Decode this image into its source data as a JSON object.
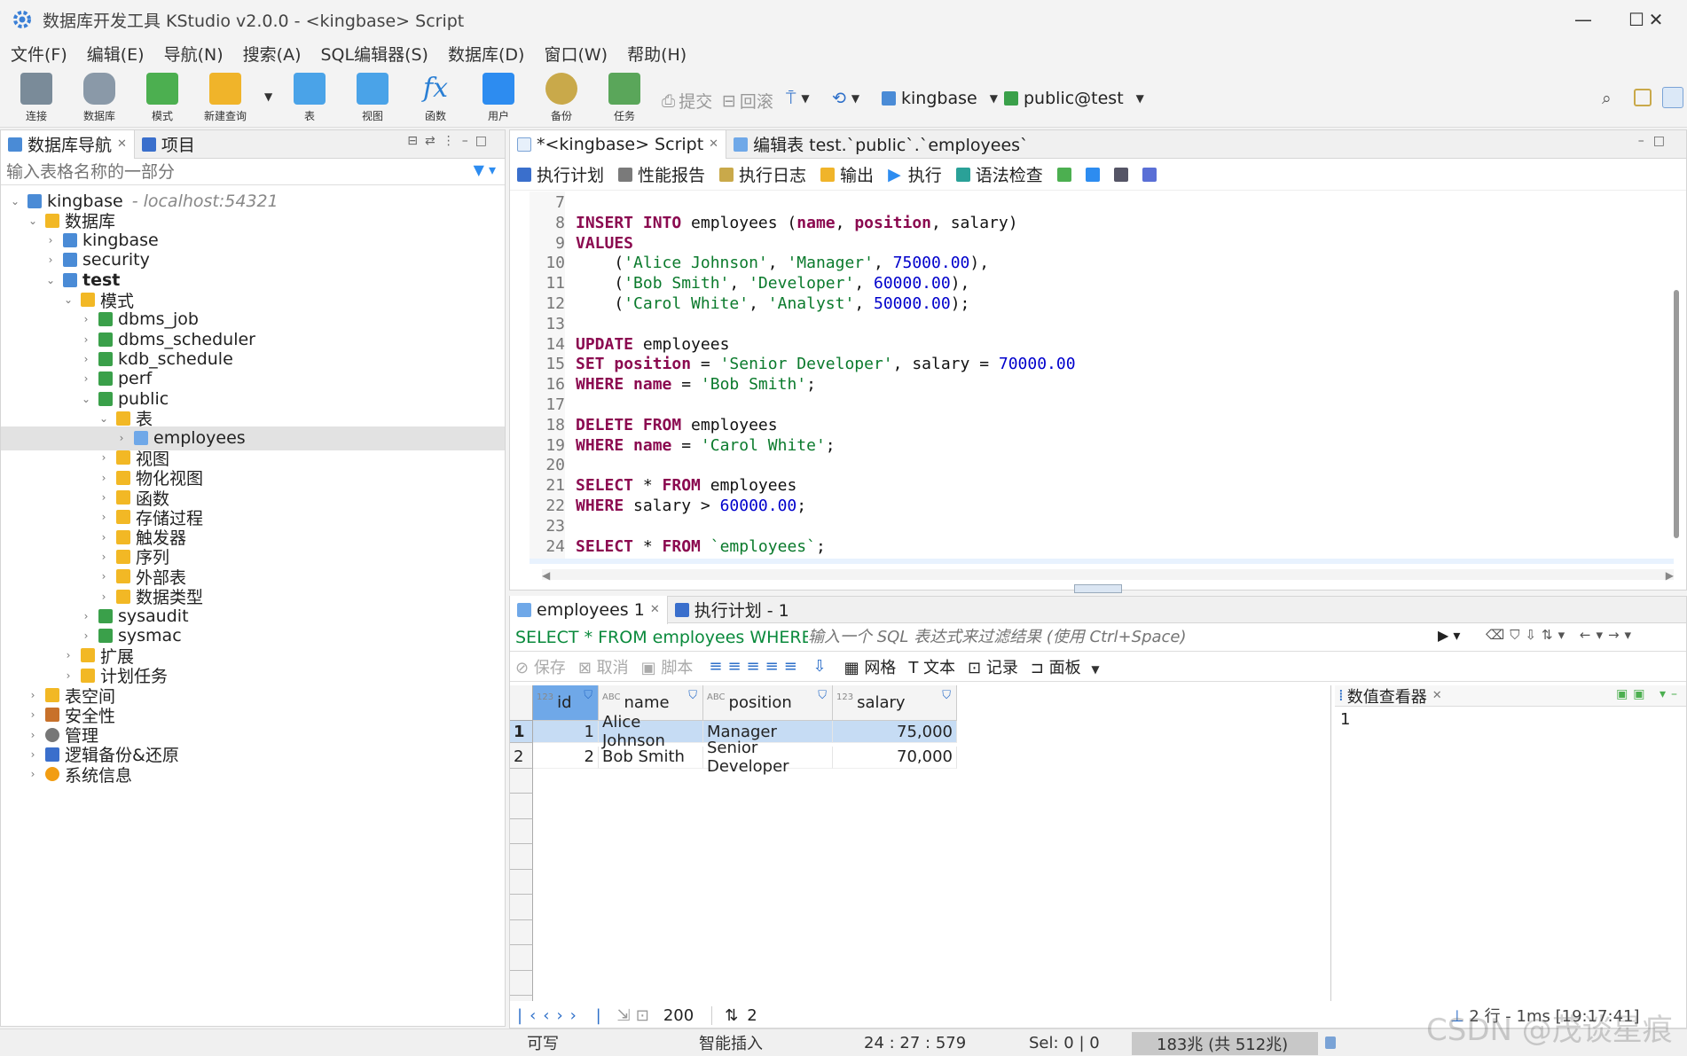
{
  "window": {
    "title": "数据库开发工具 KStudio v2.0.0 - <kingbase> Script",
    "minimize": "—",
    "maximize": "☐",
    "close": "✕"
  },
  "menu": [
    "文件(F)",
    "编辑(E)",
    "导航(N)",
    "搜索(A)",
    "SQL编辑器(S)",
    "数据库(D)",
    "窗口(W)",
    "帮助(H)"
  ],
  "toolbar": {
    "buttons": [
      {
        "label": "连接",
        "icon": "connect-icon",
        "color": "#7a8b99"
      },
      {
        "label": "数据库",
        "icon": "database-icon",
        "color": "#8a99a8"
      },
      {
        "label": "模式",
        "icon": "schema-icon",
        "color": "#4caf50"
      },
      {
        "label": "新建查询",
        "icon": "new-query-icon",
        "color": "#f0b42a"
      },
      {
        "label": "表",
        "icon": "table-icon",
        "color": "#4aa3e8"
      },
      {
        "label": "视图",
        "icon": "view-icon",
        "color": "#4aa3e8"
      },
      {
        "label": "函数",
        "icon": "function-icon",
        "color": "#2a7fd4"
      },
      {
        "label": "用户",
        "icon": "user-icon",
        "color": "#2d8cf0"
      },
      {
        "label": "备份",
        "icon": "backup-icon",
        "color": "#c9a94a"
      },
      {
        "label": "任务",
        "icon": "task-icon",
        "color": "#5aa65a"
      }
    ],
    "commit": "提交",
    "rollback": "回滚",
    "connection": "kingbase",
    "schema": "public@test"
  },
  "navigator": {
    "tab_label": "数据库导航",
    "projects_label": "项目",
    "filter_placeholder": "输入表格名称的一部分",
    "tree": [
      {
        "label": "kingbase",
        "suffix": "- localhost:54321",
        "depth": 0,
        "arrow": "⌄",
        "icon": "db"
      },
      {
        "label": "数据库",
        "depth": 1,
        "arrow": "⌄",
        "icon": "folder"
      },
      {
        "label": "kingbase",
        "depth": 2,
        "arrow": "›",
        "icon": "db"
      },
      {
        "label": "security",
        "depth": 2,
        "arrow": "›",
        "icon": "db"
      },
      {
        "label": "test",
        "depth": 2,
        "arrow": "⌄",
        "icon": "db",
        "bold": true
      },
      {
        "label": "模式",
        "depth": 3,
        "arrow": "⌄",
        "icon": "folder"
      },
      {
        "label": "dbms_job",
        "depth": 4,
        "arrow": "›",
        "icon": "schema"
      },
      {
        "label": "dbms_scheduler",
        "depth": 4,
        "arrow": "›",
        "icon": "schema"
      },
      {
        "label": "kdb_schedule",
        "depth": 4,
        "arrow": "›",
        "icon": "schema"
      },
      {
        "label": "perf",
        "depth": 4,
        "arrow": "›",
        "icon": "schema"
      },
      {
        "label": "public",
        "depth": 4,
        "arrow": "⌄",
        "icon": "schema"
      },
      {
        "label": "表",
        "depth": 5,
        "arrow": "⌄",
        "icon": "folder"
      },
      {
        "label": "employees",
        "depth": 6,
        "arrow": "›",
        "icon": "table",
        "selected": true
      },
      {
        "label": "视图",
        "depth": 5,
        "arrow": "›",
        "icon": "folder"
      },
      {
        "label": "物化视图",
        "depth": 5,
        "arrow": "›",
        "icon": "folder"
      },
      {
        "label": "函数",
        "depth": 5,
        "arrow": "›",
        "icon": "folder"
      },
      {
        "label": "存储过程",
        "depth": 5,
        "arrow": "›",
        "icon": "folder"
      },
      {
        "label": "触发器",
        "depth": 5,
        "arrow": "›",
        "icon": "folder"
      },
      {
        "label": "序列",
        "depth": 5,
        "arrow": "›",
        "icon": "folder"
      },
      {
        "label": "外部表",
        "depth": 5,
        "arrow": "›",
        "icon": "folder"
      },
      {
        "label": "数据类型",
        "depth": 5,
        "arrow": "›",
        "icon": "folder"
      },
      {
        "label": "sysaudit",
        "depth": 4,
        "arrow": "›",
        "icon": "schema"
      },
      {
        "label": "sysmac",
        "depth": 4,
        "arrow": "›",
        "icon": "schema"
      },
      {
        "label": "扩展",
        "depth": 3,
        "arrow": "›",
        "icon": "folder"
      },
      {
        "label": "计划任务",
        "depth": 3,
        "arrow": "›",
        "icon": "folder"
      },
      {
        "label": "表空间",
        "depth": 1,
        "arrow": "›",
        "icon": "folder"
      },
      {
        "label": "安全性",
        "depth": 1,
        "arrow": "›",
        "icon": "shield"
      },
      {
        "label": "管理",
        "depth": 1,
        "arrow": "›",
        "icon": "gear"
      },
      {
        "label": "逻辑备份&还原",
        "depth": 1,
        "arrow": "›",
        "icon": "stack"
      },
      {
        "label": "系统信息",
        "depth": 1,
        "arrow": "›",
        "icon": "info"
      }
    ]
  },
  "editor": {
    "tabs": [
      {
        "label": "*<kingbase> Script",
        "active": true
      },
      {
        "label": "编辑表 test.`public`.`employees`",
        "active": false
      }
    ],
    "actions": [
      "执行计划",
      "性能报告",
      "执行日志",
      "输出",
      "执行",
      "语法检查"
    ],
    "lines": [
      {
        "n": "7",
        "t": [
          {
            "c": "plain",
            "s": ""
          }
        ]
      },
      {
        "n": "8",
        "t": [
          {
            "c": "kw",
            "s": "INSERT INTO"
          },
          {
            "c": "plain",
            "s": " employees ("
          },
          {
            "c": "kw",
            "s": "name"
          },
          {
            "c": "plain",
            "s": ", "
          },
          {
            "c": "kw",
            "s": "position"
          },
          {
            "c": "plain",
            "s": ", salary)"
          }
        ]
      },
      {
        "n": "9",
        "t": [
          {
            "c": "kw",
            "s": "VALUES"
          }
        ]
      },
      {
        "n": "10",
        "t": [
          {
            "c": "plain",
            "s": "    ("
          },
          {
            "c": "str",
            "s": "'Alice Johnson'"
          },
          {
            "c": "plain",
            "s": ", "
          },
          {
            "c": "str",
            "s": "'Manager'"
          },
          {
            "c": "plain",
            "s": ", "
          },
          {
            "c": "num",
            "s": "75000.00"
          },
          {
            "c": "plain",
            "s": "),"
          }
        ]
      },
      {
        "n": "11",
        "t": [
          {
            "c": "plain",
            "s": "    ("
          },
          {
            "c": "str",
            "s": "'Bob Smith'"
          },
          {
            "c": "plain",
            "s": ", "
          },
          {
            "c": "str",
            "s": "'Developer'"
          },
          {
            "c": "plain",
            "s": ", "
          },
          {
            "c": "num",
            "s": "60000.00"
          },
          {
            "c": "plain",
            "s": "),"
          }
        ]
      },
      {
        "n": "12",
        "t": [
          {
            "c": "plain",
            "s": "    ("
          },
          {
            "c": "str",
            "s": "'Carol White'"
          },
          {
            "c": "plain",
            "s": ", "
          },
          {
            "c": "str",
            "s": "'Analyst'"
          },
          {
            "c": "plain",
            "s": ", "
          },
          {
            "c": "num",
            "s": "50000.00"
          },
          {
            "c": "plain",
            "s": ");"
          }
        ]
      },
      {
        "n": "13",
        "t": [
          {
            "c": "plain",
            "s": ""
          }
        ]
      },
      {
        "n": "14",
        "t": [
          {
            "c": "kw",
            "s": "UPDATE"
          },
          {
            "c": "plain",
            "s": " employees"
          }
        ]
      },
      {
        "n": "15",
        "t": [
          {
            "c": "kw",
            "s": "SET"
          },
          {
            "c": "plain",
            "s": " "
          },
          {
            "c": "kw",
            "s": "position"
          },
          {
            "c": "plain",
            "s": " = "
          },
          {
            "c": "str",
            "s": "'Senior Developer'"
          },
          {
            "c": "plain",
            "s": ", salary = "
          },
          {
            "c": "num",
            "s": "70000.00"
          }
        ]
      },
      {
        "n": "16",
        "t": [
          {
            "c": "kw",
            "s": "WHERE"
          },
          {
            "c": "plain",
            "s": " "
          },
          {
            "c": "kw",
            "s": "name"
          },
          {
            "c": "plain",
            "s": " = "
          },
          {
            "c": "str",
            "s": "'Bob Smith'"
          },
          {
            "c": "plain",
            "s": ";"
          }
        ]
      },
      {
        "n": "17",
        "t": [
          {
            "c": "plain",
            "s": ""
          }
        ]
      },
      {
        "n": "18",
        "t": [
          {
            "c": "kw",
            "s": "DELETE FROM"
          },
          {
            "c": "plain",
            "s": " employees"
          }
        ]
      },
      {
        "n": "19",
        "t": [
          {
            "c": "kw",
            "s": "WHERE"
          },
          {
            "c": "plain",
            "s": " "
          },
          {
            "c": "kw",
            "s": "name"
          },
          {
            "c": "plain",
            "s": " = "
          },
          {
            "c": "str",
            "s": "'Carol White'"
          },
          {
            "c": "plain",
            "s": ";"
          }
        ]
      },
      {
        "n": "20",
        "t": [
          {
            "c": "plain",
            "s": ""
          }
        ]
      },
      {
        "n": "21",
        "t": [
          {
            "c": "kw",
            "s": "SELECT"
          },
          {
            "c": "plain",
            "s": " * "
          },
          {
            "c": "kw",
            "s": "FROM"
          },
          {
            "c": "plain",
            "s": " employees"
          }
        ]
      },
      {
        "n": "22",
        "t": [
          {
            "c": "kw",
            "s": "WHERE"
          },
          {
            "c": "plain",
            "s": " salary > "
          },
          {
            "c": "num",
            "s": "60000.00"
          },
          {
            "c": "plain",
            "s": ";"
          }
        ]
      },
      {
        "n": "23",
        "t": [
          {
            "c": "plain",
            "s": ""
          }
        ]
      },
      {
        "n": "24",
        "t": [
          {
            "c": "kw",
            "s": "SELECT"
          },
          {
            "c": "plain",
            "s": " * "
          },
          {
            "c": "kw",
            "s": "FROM"
          },
          {
            "c": "plain",
            "s": " "
          },
          {
            "c": "str",
            "s": "`employees`"
          },
          {
            "c": "plain",
            "s": ";"
          }
        ]
      }
    ]
  },
  "results": {
    "tabs": [
      {
        "label": "employees 1",
        "active": true
      },
      {
        "label": "执行计划 - 1",
        "active": false
      }
    ],
    "query": "SELECT * FROM employees WHERE",
    "filter_placeholder": "输入一个 SQL 表达式来过滤结果 (使用 Ctrl+Space)",
    "actions": {
      "save": "保存",
      "cancel": "取消",
      "script": "脚本",
      "grid": "网格",
      "text": "文本",
      "record": "记录",
      "panel": "面板"
    },
    "columns": [
      {
        "type": "123",
        "name": "id"
      },
      {
        "type": "ABC",
        "name": "name"
      },
      {
        "type": "ABC",
        "name": "position"
      },
      {
        "type": "123",
        "name": "salary"
      }
    ],
    "rows": [
      {
        "num": "1",
        "cells": [
          "1",
          "Alice Johnson",
          "Manager",
          "75,000"
        ]
      },
      {
        "num": "2",
        "cells": [
          "2",
          "Bob Smith",
          "Senior Developer",
          "70,000"
        ]
      }
    ],
    "fetch_size": "200",
    "row_count": "2",
    "summary": "2 行 - 1ms [19:17:41]",
    "value_viewer": {
      "title": "数值查看器",
      "value": "1"
    }
  },
  "statusbar": {
    "mode": "可写",
    "insert": "智能插入",
    "position": "24 : 27 : 579",
    "selection": "Sel: 0 | 0",
    "memory": "183兆 (共 512兆)"
  },
  "watermark": "CSDN @茂谈星痕",
  "colors": {
    "keyword": "#8b0a50",
    "string": "#0a7a2c",
    "number": "#0000cc",
    "selection": "#c6dcf4",
    "accent": "#2d6fc9"
  }
}
